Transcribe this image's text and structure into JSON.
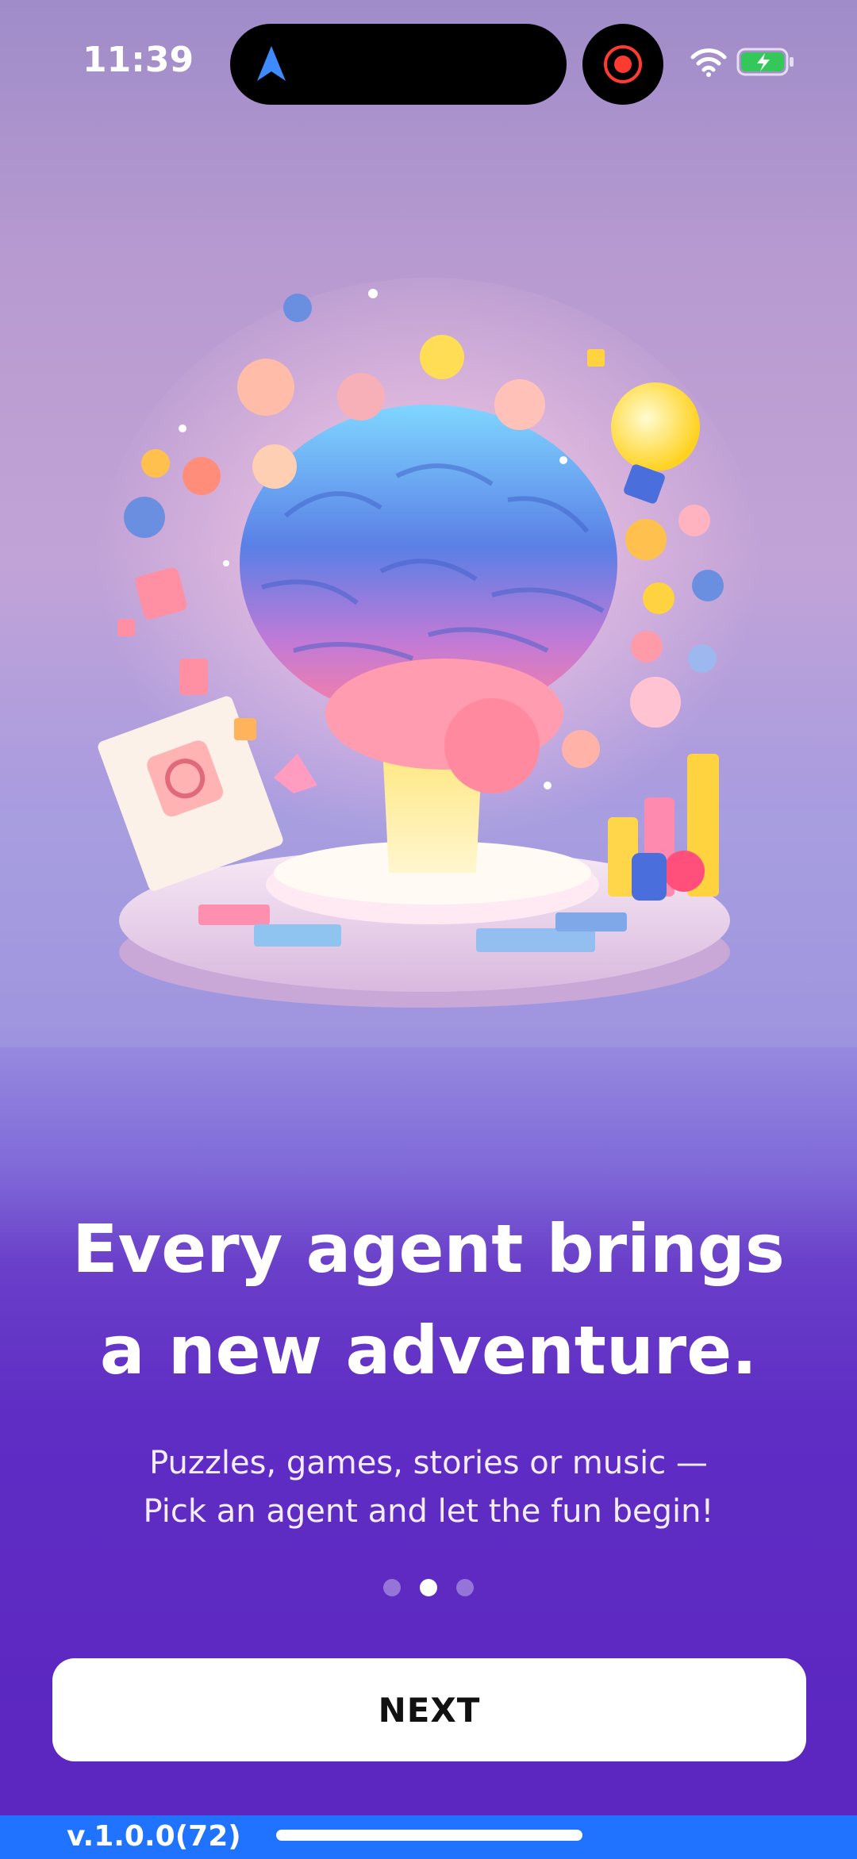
{
  "status_bar": {
    "time": "11:39"
  },
  "onboarding": {
    "headline_line1": "Every agent brings",
    "headline_line2": "a new adventure.",
    "subtitle_line1": "Puzzles, games, stories or music —",
    "subtitle_line2": "Pick an agent and let the fun begin!",
    "page_total": 3,
    "page_current": 2
  },
  "actions": {
    "next_label": "NEXT"
  },
  "footer": {
    "version": "v.1.0.0(72)"
  },
  "icons": [
    "navigation-arrow-icon",
    "record-icon",
    "wifi-icon",
    "battery-charging-icon"
  ],
  "colors": {
    "accent_purple": "#5b25c0",
    "footer_blue": "#1f73ff"
  }
}
